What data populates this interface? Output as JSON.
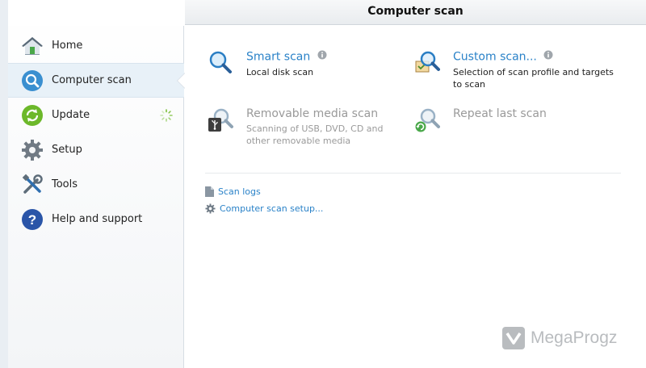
{
  "header": {
    "title": "Computer scan"
  },
  "sidebar": {
    "items": [
      {
        "label": "Home",
        "icon": "home-icon"
      },
      {
        "label": "Computer scan",
        "icon": "computer-scan-icon"
      },
      {
        "label": "Update",
        "icon": "update-icon"
      },
      {
        "label": "Setup",
        "icon": "gear-icon"
      },
      {
        "label": "Tools",
        "icon": "tools-icon"
      },
      {
        "label": "Help and support",
        "icon": "help-icon"
      }
    ]
  },
  "scans": {
    "smart": {
      "title": "Smart scan",
      "desc": "Local disk scan"
    },
    "custom": {
      "title": "Custom scan...",
      "desc": "Selection of scan profile and targets to scan"
    },
    "removable": {
      "title": "Removable media scan",
      "desc": "Scanning of USB, DVD, CD and other removable media"
    },
    "repeat": {
      "title": "Repeat last scan"
    }
  },
  "links": {
    "logs": "Scan logs",
    "setup": "Computer scan setup..."
  },
  "watermark": {
    "text": "MegaProgz"
  },
  "colors": {
    "accent": "#2a82c8",
    "disabled": "#9a9a9a"
  }
}
